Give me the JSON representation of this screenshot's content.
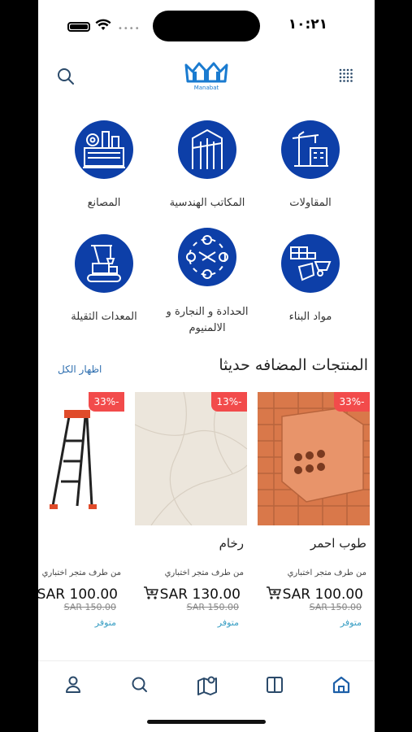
{
  "status": {
    "time": "١٠:٢١"
  },
  "header": {
    "logo_text": "Manabat",
    "search_icon": "search-icon",
    "menu_icon": "grid-menu-icon"
  },
  "categories": [
    {
      "label": "المقاولات",
      "icon": "crane-building-icon"
    },
    {
      "label": "المكاتب الهندسية",
      "icon": "engineering-office-icon"
    },
    {
      "label": "المصانع",
      "icon": "factory-icon"
    },
    {
      "label": "مواد البناء",
      "icon": "building-materials-icon"
    },
    {
      "label": "الحدادة و النجارة و الالمنيوم",
      "icon": "tools-icon"
    },
    {
      "label": "المعدات الثقيلة",
      "icon": "heavy-equipment-icon"
    }
  ],
  "recent": {
    "title": "المنتجات المضافه حديثا",
    "show_all": "اظهار الكل",
    "products": [
      {
        "name": "طوب احمر",
        "discount": "33%-",
        "vendor": "من طرف متجر اختباري",
        "price": "SAR 100.00",
        "old_price": "SAR 150.00",
        "availability": "متوفر"
      },
      {
        "name": "رخام",
        "discount": "13%-",
        "vendor": "من طرف متجر اختباري",
        "price": "SAR 130.00",
        "old_price": "SAR 150.00",
        "availability": "متوفر"
      },
      {
        "name": "",
        "discount": "33%-",
        "vendor": "من طرف متجر اختباري",
        "price": "SAR 100.00",
        "old_price": "SAR 150.00",
        "availability": "متوفر"
      }
    ]
  },
  "bottom_nav": [
    {
      "icon": "profile-icon"
    },
    {
      "icon": "search-icon"
    },
    {
      "icon": "map-icon"
    },
    {
      "icon": "book-icon"
    },
    {
      "icon": "home-icon",
      "active": true
    }
  ],
  "colors": {
    "brand": "#0d3fa8",
    "badge": "#f24b4b",
    "link": "#2f6fb0",
    "available": "#3a9fc4",
    "nav_active": "#1c5fa8",
    "nav_inactive": "#2b4a6a"
  }
}
